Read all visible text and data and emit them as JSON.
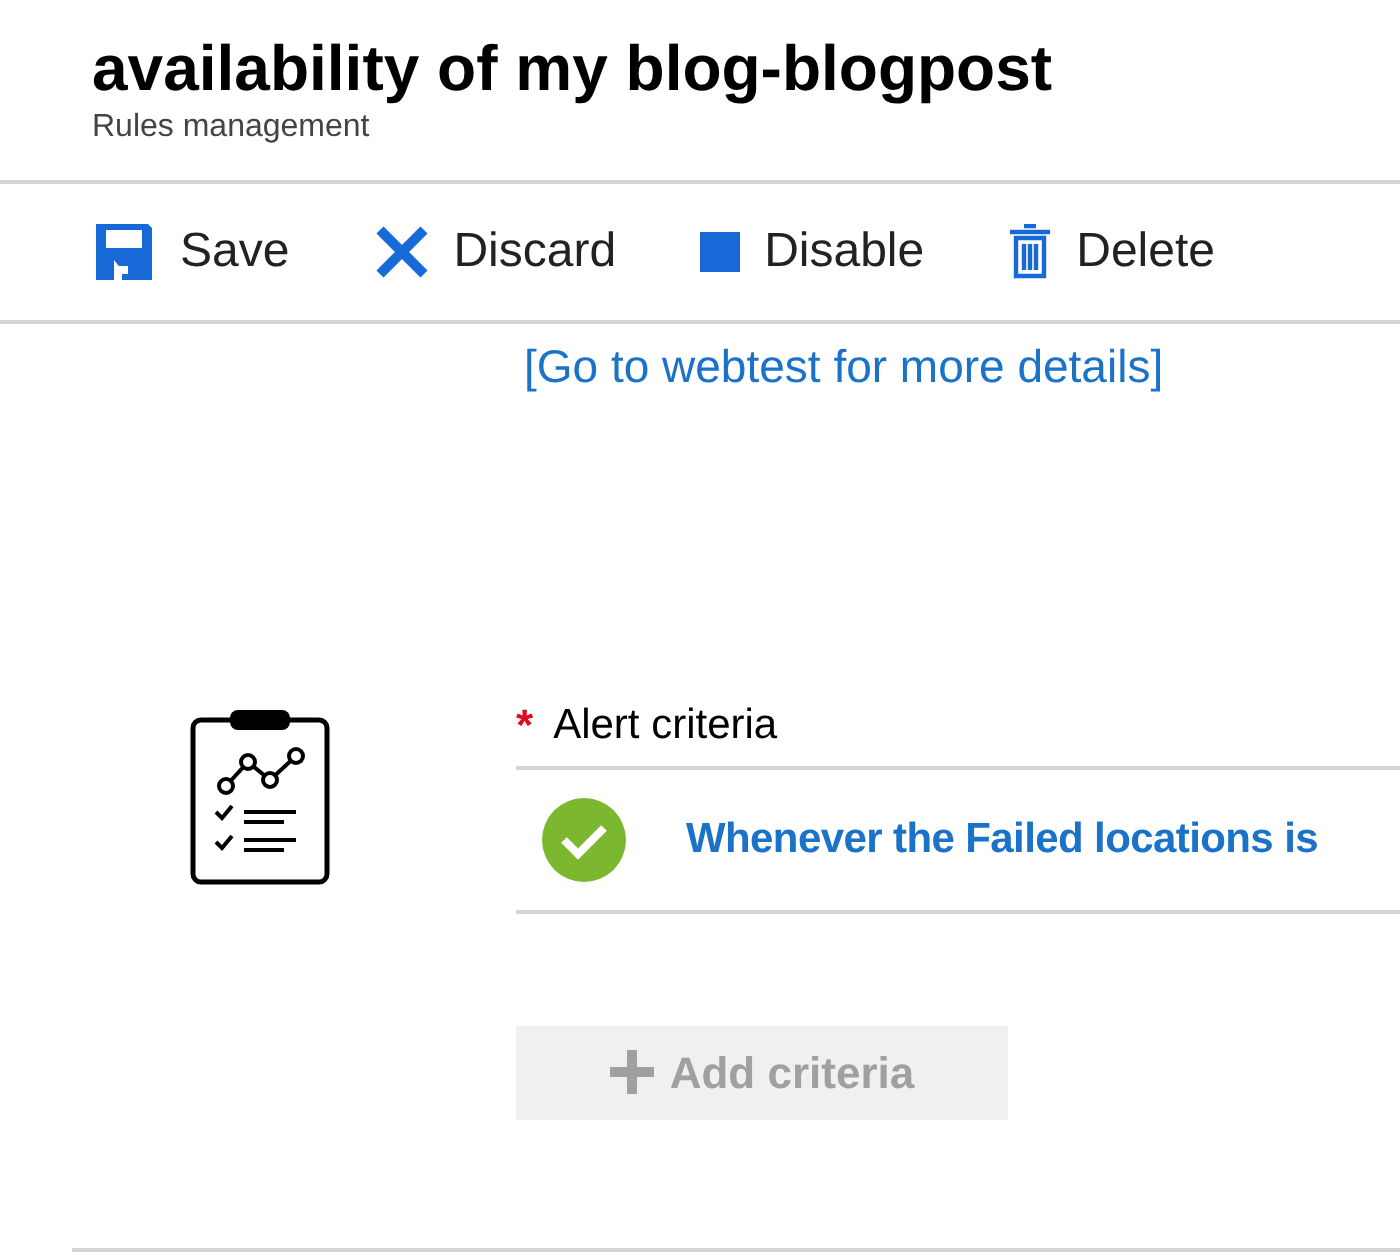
{
  "header": {
    "title": "availability of my blog-blogpost",
    "subtitle": "Rules management"
  },
  "toolbar": [
    {
      "kind": "save",
      "label": "Save"
    },
    {
      "kind": "discard",
      "label": "Discard"
    },
    {
      "kind": "disable",
      "label": "Disable"
    },
    {
      "kind": "delete",
      "label": "Delete"
    }
  ],
  "webtest_link": "[Go to webtest for more details]",
  "alert_criteria": {
    "required_mark": "*",
    "label": "Alert criteria",
    "criteria": [
      {
        "valid": true,
        "text": "Whenever the Failed locations is"
      }
    ],
    "add_button": {
      "label": "Add criteria",
      "disabled": true
    }
  }
}
